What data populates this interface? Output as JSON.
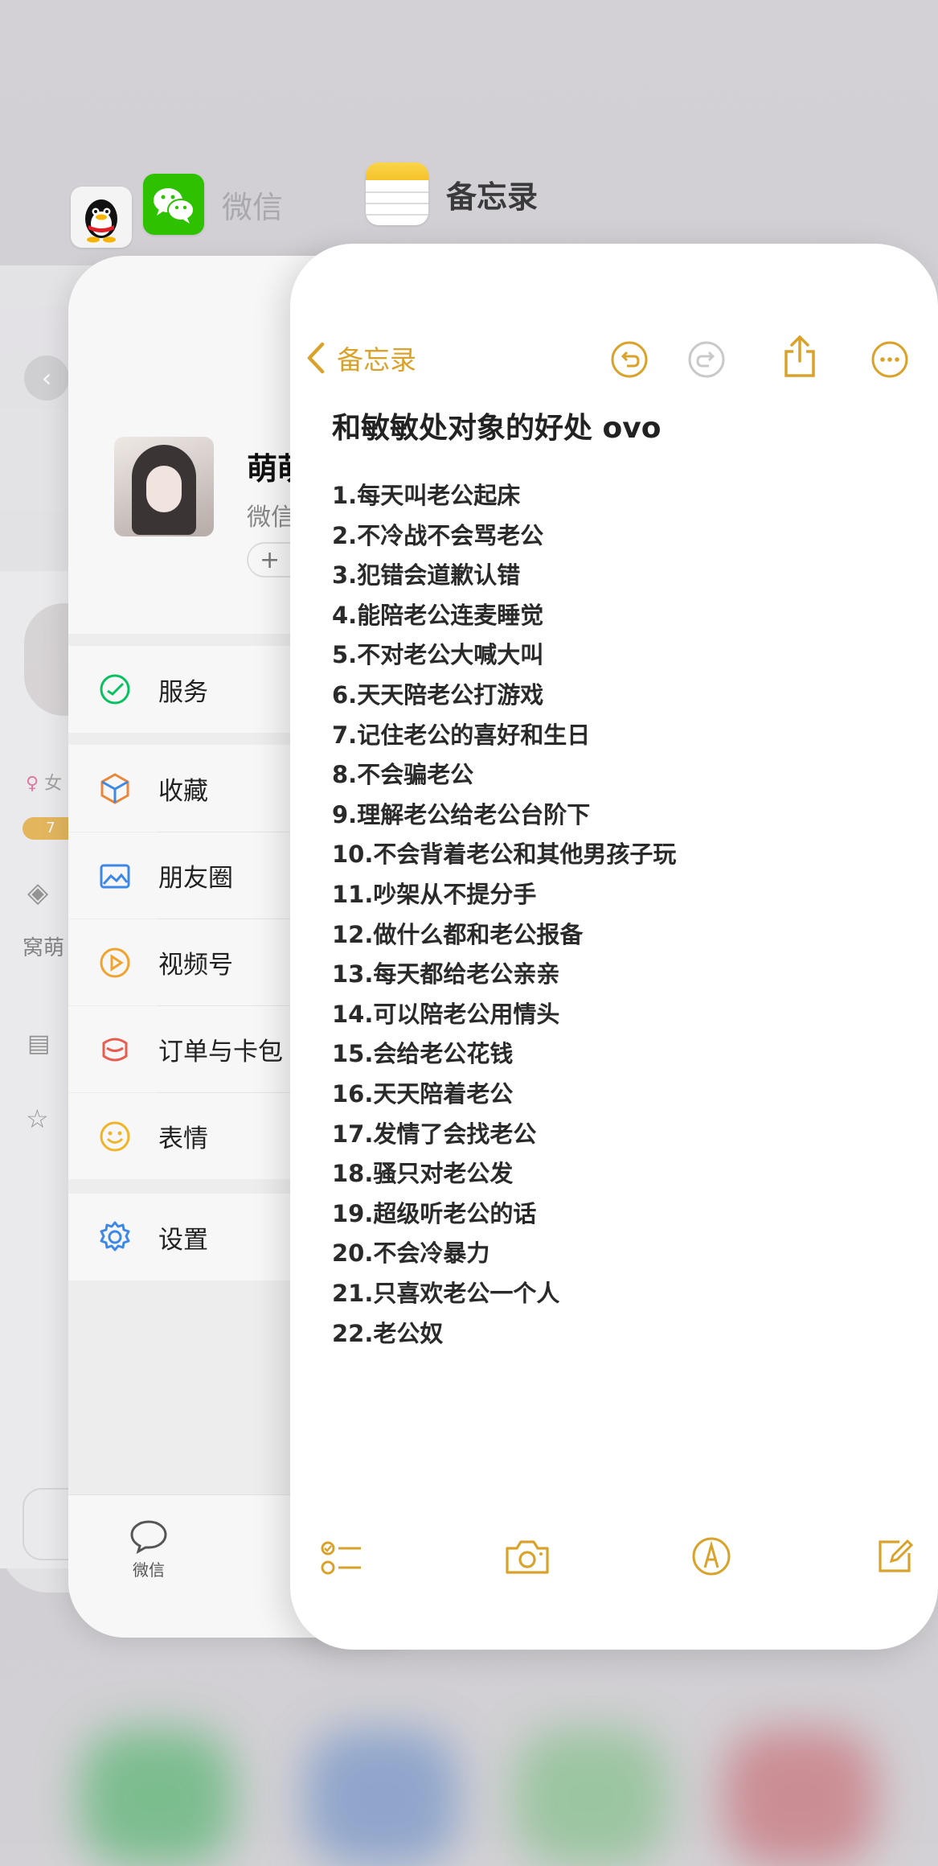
{
  "switcher": {
    "wechat_name": "微信",
    "notes_name": "备忘录"
  },
  "qq_card": {
    "gender": "女",
    "level": "7",
    "name_fragment": "窝萌"
  },
  "wechat": {
    "profile_name": "萌萌",
    "profile_sub": "微信",
    "add_status": "+",
    "menu": [
      {
        "label": "服务",
        "icon": "services-icon",
        "color": "#07c160"
      },
      {
        "label": "收藏",
        "icon": "favorites-icon",
        "color": "#e9863a"
      },
      {
        "label": "朋友圈",
        "icon": "moments-icon",
        "color": "#3d87e6"
      },
      {
        "label": "视频号",
        "icon": "channels-icon",
        "color": "#f0a32e"
      },
      {
        "label": "订单与卡包",
        "icon": "orders-cards-icon",
        "color": "#e65c4f"
      },
      {
        "label": "表情",
        "icon": "stickers-icon",
        "color": "#f0b429"
      },
      {
        "label": "设置",
        "icon": "settings-icon",
        "color": "#3d87e6"
      }
    ],
    "tabbar": {
      "chats_label": "微信"
    }
  },
  "notes": {
    "back_label": "备忘录",
    "title": "和敏敏处对象的好处 ovo",
    "lines": [
      "1.每天叫老公起床",
      "2.不冷战不会骂老公",
      "3.犯错会道歉认错",
      "4.能陪老公连麦睡觉",
      "5.不对老公大喊大叫",
      "6.天天陪老公打游戏",
      "7.记住老公的喜好和生日",
      "8.不会骗老公",
      "9.理解老公给老公台阶下",
      "10.不会背着老公和其他男孩子玩",
      "11.吵架从不提分手",
      "12.做什么都和老公报备",
      "13.每天都给老公亲亲",
      "14.可以陪老公用情头",
      "15.会给老公花钱",
      "16.天天陪着老公",
      "17.发情了会找老公",
      "18.骚只对老公发",
      "19.超级听老公的话",
      "20.不会冷暴力",
      "21.只喜欢老公一个人",
      "22.老公奴"
    ],
    "accent_color": "#d9a32b"
  }
}
